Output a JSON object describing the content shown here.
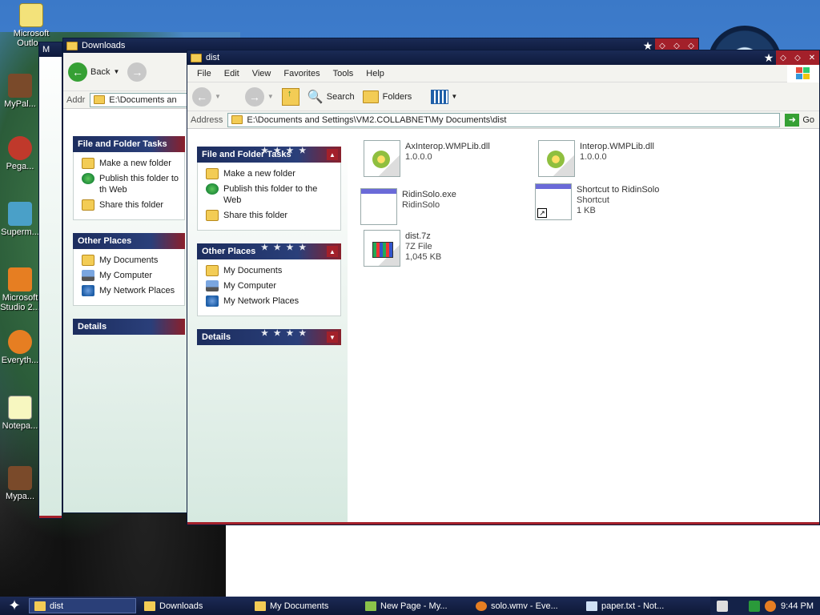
{
  "desktop": {
    "icons": [
      {
        "label": "Microsoft Outlo..."
      },
      {
        "label": "MyPal..."
      },
      {
        "label": "Pega..."
      },
      {
        "label": "Superm..."
      },
      {
        "label": "Microsoft Studio 2..."
      },
      {
        "label": "Everyth..."
      },
      {
        "label": "Notepa..."
      },
      {
        "label": "Mypa..."
      }
    ]
  },
  "win_back2": {
    "title": "M"
  },
  "win_downloads": {
    "title": "Downloads",
    "back_label": "Back",
    "address_label": "Addr",
    "address_value": "E:\\Documents an",
    "tasks_title": "File and Folder Tasks",
    "tasks": [
      "Make a new folder",
      "Publish this folder to th Web",
      "Share this folder"
    ],
    "places_title": "Other Places",
    "places": [
      "My Documents",
      "My Computer",
      "My Network Places"
    ],
    "details_title": "Details"
  },
  "win_dist": {
    "title": "dist",
    "menu": [
      "File",
      "Edit",
      "View",
      "Favorites",
      "Tools",
      "Help"
    ],
    "toolbar": {
      "search": "Search",
      "folders": "Folders"
    },
    "address_label": "Address",
    "address_value": "E:\\Documents and Settings\\VM2.COLLABNET\\My Documents\\dist",
    "go_label": "Go",
    "tasks_title": "File and Folder Tasks",
    "tasks": [
      "Make a new folder",
      "Publish this folder to the Web",
      "Share this folder"
    ],
    "places_title": "Other Places",
    "places": [
      "My Documents",
      "My Computer",
      "My Network Places"
    ],
    "details_title": "Details",
    "files": [
      {
        "name": "AxInterop.WMPLib.dll",
        "line2": "1.0.0.0",
        "line3": "",
        "icon": "dll"
      },
      {
        "name": "Interop.WMPLib.dll",
        "line2": "1.0.0.0",
        "line3": "",
        "icon": "dll"
      },
      {
        "name": "RidinSolo.exe",
        "line2": "RidinSolo",
        "line3": "",
        "icon": "exe"
      },
      {
        "name": "Shortcut to RidinSolo",
        "line2": "Shortcut",
        "line3": "1 KB",
        "icon": "shortcut"
      },
      {
        "name": "dist.7z",
        "line2": "7Z File",
        "line3": "1,045 KB",
        "icon": "7z"
      }
    ]
  },
  "taskbar": {
    "tasks": [
      {
        "label": "dist",
        "active": true
      },
      {
        "label": "Downloads",
        "active": false
      },
      {
        "label": "My Documents",
        "active": false
      },
      {
        "label": "New Page - My...",
        "active": false
      },
      {
        "label": "solo.wmv - Eve...",
        "active": false
      },
      {
        "label": "paper.txt - Not...",
        "active": false
      }
    ],
    "clock": "9:44 PM"
  },
  "colors": {
    "titlebar": "#0e1a3c",
    "accent_red": "#a3202a",
    "pane_gradient_end": "#d6e9e0"
  }
}
